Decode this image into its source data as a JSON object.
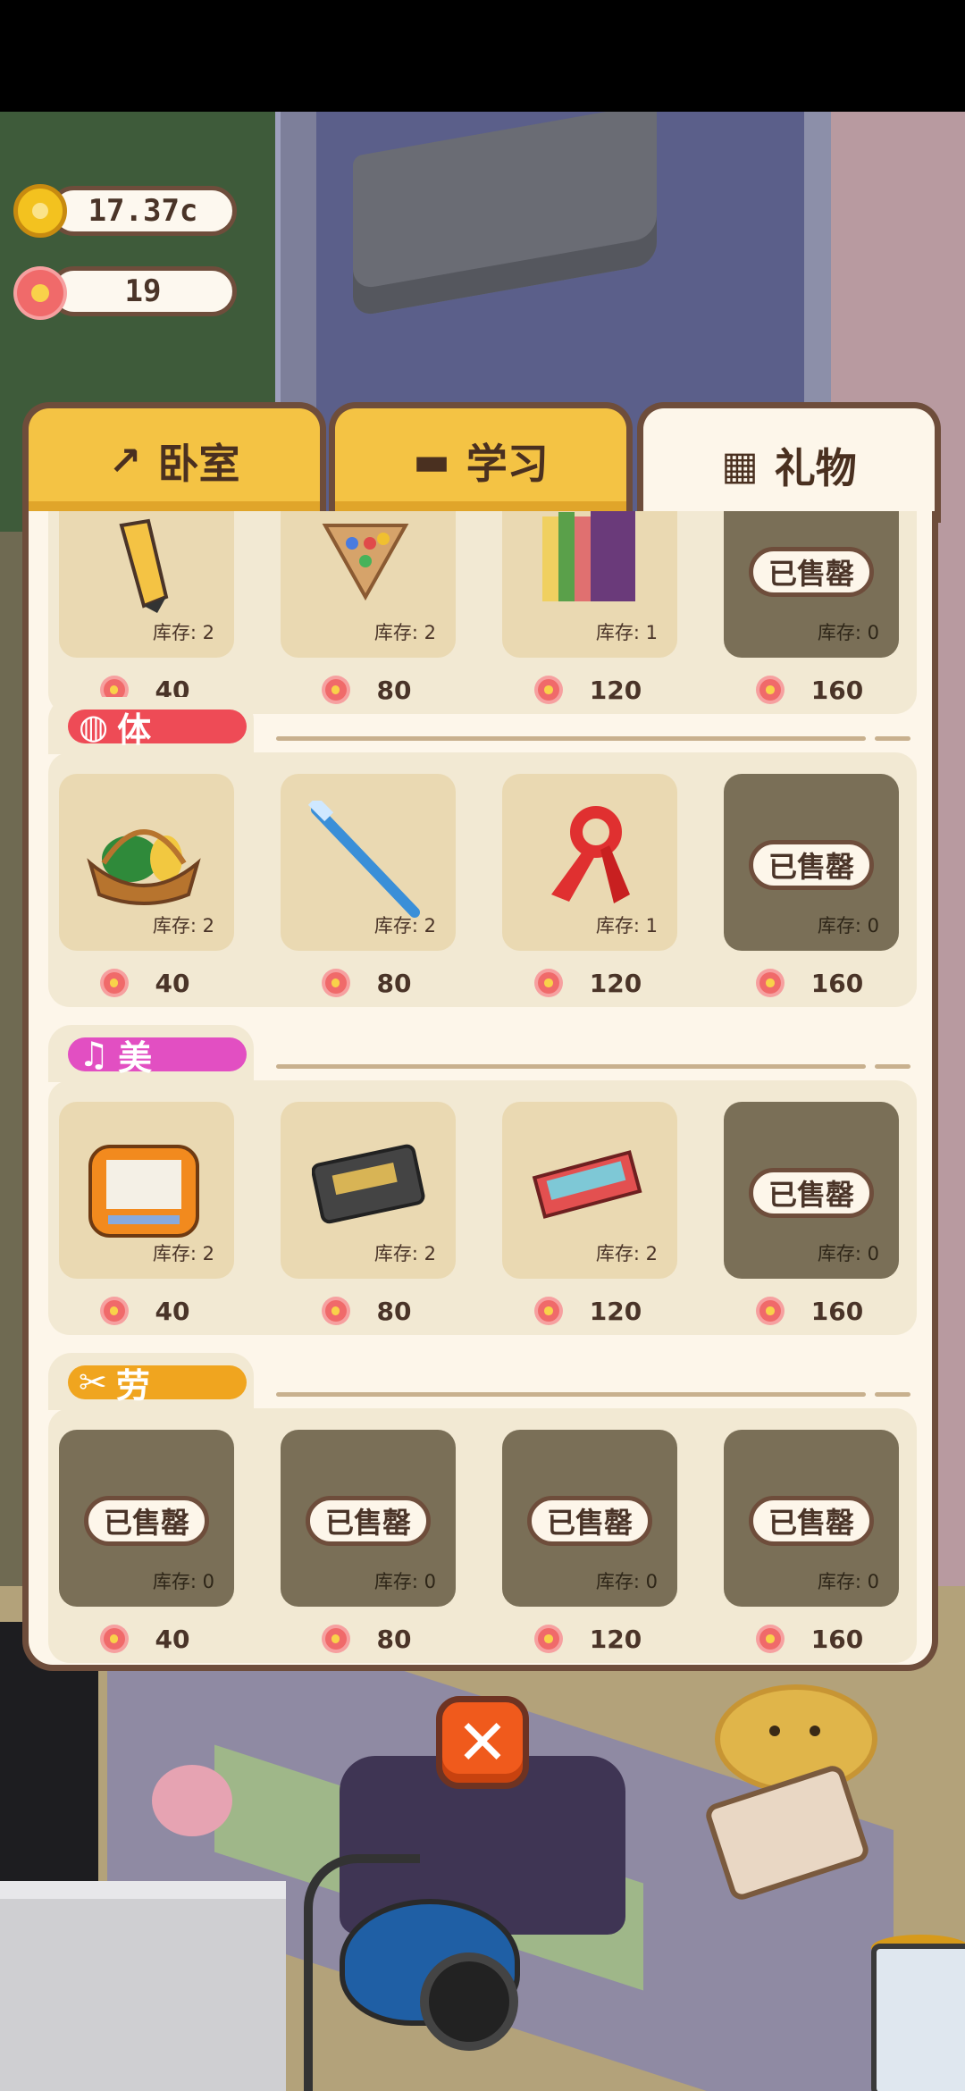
{
  "hud": {
    "coins": "17.37c",
    "flowers": "19"
  },
  "tabs": [
    {
      "label": "卧室",
      "icon": "pickaxe-icon",
      "active": false
    },
    {
      "label": "学习",
      "icon": "graduation-cap-icon",
      "active": false
    },
    {
      "label": "礼物",
      "icon": "gift-icon",
      "active": true
    }
  ],
  "sold_out_label": "已售罄",
  "sections": [
    {
      "title": "",
      "items": [
        {
          "name": "pencil",
          "stock": "库存: 2",
          "price": "40",
          "sold": false
        },
        {
          "name": "chinese-checkers",
          "stock": "库存: 2",
          "price": "80",
          "sold": false
        },
        {
          "name": "books",
          "stock": "库存: 1",
          "price": "120",
          "sold": false
        },
        {
          "name": "bowl",
          "stock": "库存: 0",
          "price": "160",
          "sold": true
        }
      ]
    },
    {
      "title": "体",
      "color": "#ee4b56",
      "icon": "basketball-icon",
      "items": [
        {
          "name": "fruit-basket",
          "stock": "库存: 2",
          "price": "40",
          "sold": false
        },
        {
          "name": "toothbrush",
          "stock": "库存: 2",
          "price": "80",
          "sold": false
        },
        {
          "name": "scarf",
          "stock": "库存: 1",
          "price": "120",
          "sold": false
        },
        {
          "name": "sneakers",
          "stock": "库存: 0",
          "price": "160",
          "sold": true
        }
      ]
    },
    {
      "title": "美",
      "color": "#e24fc2",
      "icon": "music-note-icon",
      "items": [
        {
          "name": "drawing-board",
          "stock": "库存: 2",
          "price": "40",
          "sold": false
        },
        {
          "name": "cassette",
          "stock": "库存: 2",
          "price": "80",
          "sold": false
        },
        {
          "name": "crayon-box",
          "stock": "库存: 2",
          "price": "120",
          "sold": false
        },
        {
          "name": "music-box",
          "stock": "库存: 0",
          "price": "160",
          "sold": true
        }
      ]
    },
    {
      "title": "劳",
      "color": "#f0a51f",
      "icon": "scissors-icon",
      "items": [
        {
          "name": "plant-pots",
          "stock": "库存: 0",
          "price": "40",
          "sold": true
        },
        {
          "name": "hat",
          "stock": "库存: 0",
          "price": "80",
          "sold": true
        },
        {
          "name": "suitcase",
          "stock": "库存: 0",
          "price": "120",
          "sold": true
        },
        {
          "name": "picture-frame",
          "stock": "库存: 0",
          "price": "160",
          "sold": true
        }
      ]
    }
  ],
  "close_icon": "close-icon"
}
